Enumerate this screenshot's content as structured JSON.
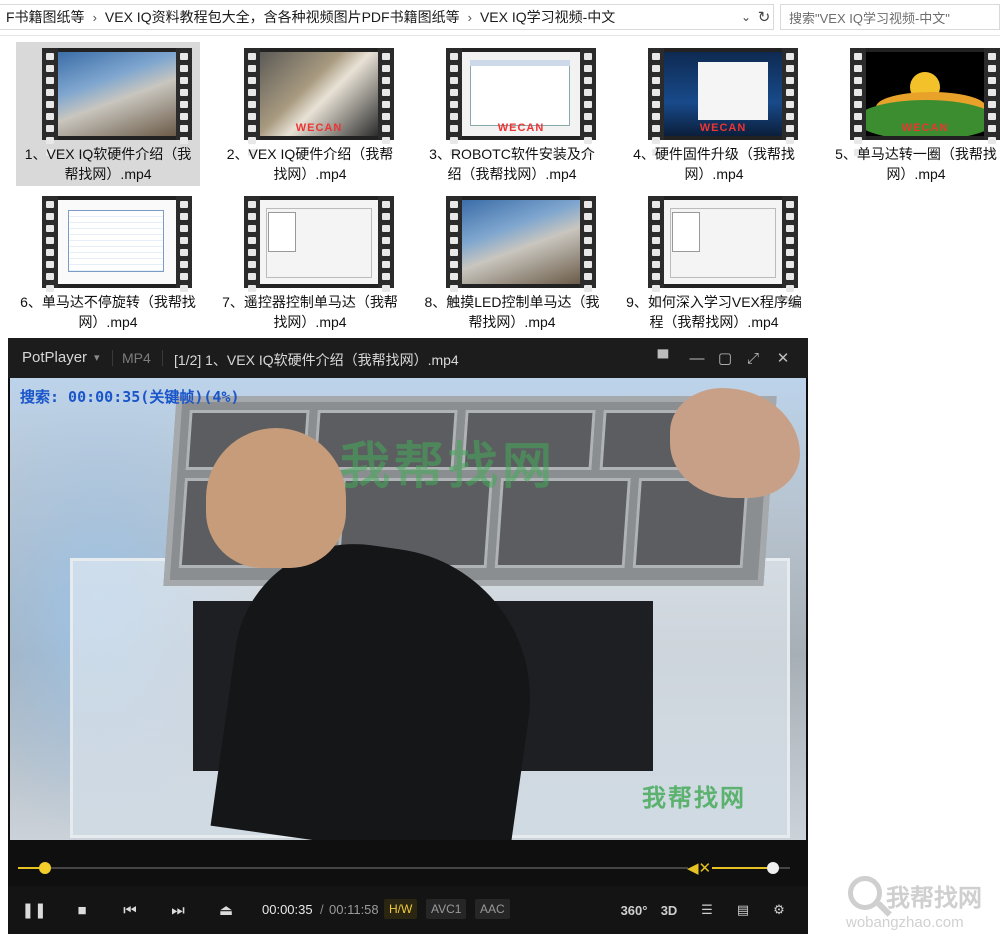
{
  "address_bar": {
    "breadcrumbs": [
      "F书籍图纸等",
      "VEX IQ资料教程包大全，含各种视频图片PDF书籍图纸等",
      "VEX IQ学习视频-中文"
    ],
    "search_placeholder": "搜索\"VEX IQ学习视频-中文\""
  },
  "files": [
    {
      "name": "1、VEX IQ软硬件介绍（我帮找网）.mp4",
      "selected": true,
      "thumb": "photo"
    },
    {
      "name": "2、VEX IQ硬件介绍（我帮找网）.mp4",
      "selected": false,
      "thumb": "photo2",
      "brand": "WECAN"
    },
    {
      "name": "3、ROBOTC软件安装及介绍（我帮找网）.mp4",
      "selected": false,
      "thumb": "screen",
      "brand": "WECAN"
    },
    {
      "name": "4、硬件固件升级（我帮找网）.mp4",
      "selected": false,
      "thumb": "desk",
      "brand": "WECAN"
    },
    {
      "name": "5、单马达转一圈（我帮找网）.mp4",
      "selected": false,
      "thumb": "sun",
      "brand": "WECAN"
    },
    {
      "name": "6、单马达不停旋转（我帮找网）.mp4",
      "selected": false,
      "thumb": "table"
    },
    {
      "name": "7、遥控器控制单马达（我帮找网）.mp4",
      "selected": false,
      "thumb": "app"
    },
    {
      "name": "8、触摸LED控制单马达（我帮找网）.mp4",
      "selected": false,
      "thumb": "photo"
    },
    {
      "name": "9、如何深入学习VEX程序编程（我帮找网）.mp4",
      "selected": false,
      "thumb": "app"
    }
  ],
  "player": {
    "app_name": "PotPlayer",
    "format": "MP4",
    "title": "[1/2] 1、VEX IQ软硬件介绍（我帮找网）.mp4",
    "osd": "搜索: 00:00:35(关键帧)(4%)",
    "watermark": "我帮找网",
    "progress": 0.04,
    "volume": 0.78,
    "time_current": "00:00:35",
    "time_separator": "/",
    "time_total": "00:11:58",
    "badge_hw": "H/W",
    "badge_video": "AVC1",
    "badge_audio": "AAC",
    "btn_360": "360°",
    "btn_3d": "3D",
    "accent_color": "#e6c223"
  },
  "site_watermark": {
    "name": "我帮找网",
    "url": "wobangzhao.com"
  }
}
